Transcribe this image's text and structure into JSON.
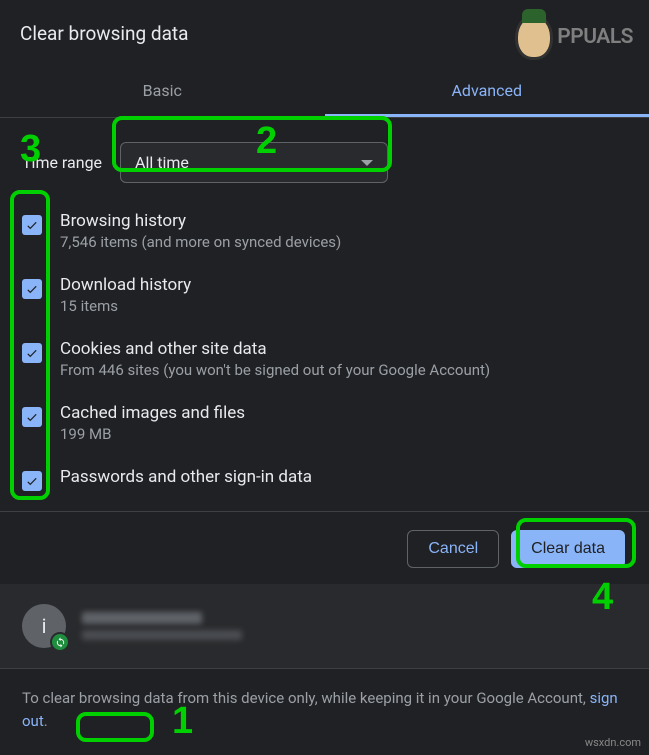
{
  "dialog": {
    "title": "Clear browsing data",
    "tabs": {
      "basic": "Basic",
      "advanced": "Advanced"
    },
    "range_label": "Time range",
    "range_value": "All time",
    "options": [
      {
        "label": "Browsing history",
        "sub": "7,546 items (and more on synced devices)"
      },
      {
        "label": "Download history",
        "sub": "15 items"
      },
      {
        "label": "Cookies and other site data",
        "sub": "From 446 sites (you won't be signed out of your Google Account)"
      },
      {
        "label": "Cached images and files",
        "sub": "199 MB"
      },
      {
        "label": "Passwords and other sign-in data",
        "sub": ""
      }
    ],
    "buttons": {
      "cancel": "Cancel",
      "clear": "Clear data"
    },
    "account": {
      "initial": "i"
    },
    "footer": {
      "prefix": "To clear browsing data from this device only, while keeping it in your Google Account, ",
      "link": "sign out",
      "suffix": "."
    }
  },
  "annotations": {
    "n1": "1",
    "n2": "2",
    "n3": "3",
    "n4": "4"
  },
  "branding": {
    "logo_text": "PPUALS",
    "watermark": "wsxdn.com"
  }
}
